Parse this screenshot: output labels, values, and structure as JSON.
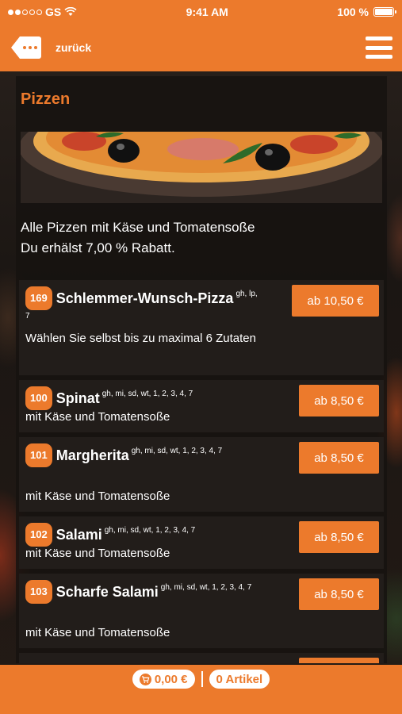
{
  "statusbar": {
    "carrier": "GS",
    "time": "9:41 AM",
    "battery": "100 %",
    "battery_level": 1.0
  },
  "navbar": {
    "back_label": "zurück",
    "back_icon": "back-arrow-icon",
    "menu_icon": "hamburger-menu-icon"
  },
  "category": {
    "title": "Pizzen",
    "intro_line1": "Alle Pizzen mit Käse und Tomatensoße",
    "intro_line2": "Du erhälst 7,00 % Rabatt."
  },
  "items": [
    {
      "number": "169",
      "name": "Schlemmer-Wunsch-Pizza",
      "allergens": "gh, lp, 7",
      "description": "Wählen Sie selbst bis zu maximal 6 Zutaten",
      "price": "ab 10,50 €"
    },
    {
      "number": "100",
      "name": "Spinat",
      "allergens": "gh, mi, sd, wt, 1, 2, 3, 4, 7",
      "description": "mit Käse und Tomatensoße",
      "price": "ab 8,50 €"
    },
    {
      "number": "101",
      "name": "Margherita",
      "allergens": "gh, mi, sd, wt, 1, 2, 3, 4, 7",
      "description": "mit Käse und Tomatensoße",
      "price": "ab 8,50 €"
    },
    {
      "number": "102",
      "name": "Salami",
      "allergens": "gh, mi, sd, wt, 1, 2, 3, 4, 7",
      "description": "mit Käse und Tomatensoße",
      "price": "ab 8,50 €"
    },
    {
      "number": "103",
      "name": "Scharfe Salami",
      "allergens": "gh, mi, sd, wt, 1, 2, 3, 4, 7",
      "description": "mit Käse und Tomatensoße",
      "price": "ab 8,50 €"
    }
  ],
  "footer": {
    "cart_total": "0,00 €",
    "cart_icon": "shopping-cart-icon",
    "article_count": "0 Artikel"
  },
  "colors": {
    "accent": "#ec7a2c",
    "panel": "#161210",
    "text": "#ffffff"
  }
}
